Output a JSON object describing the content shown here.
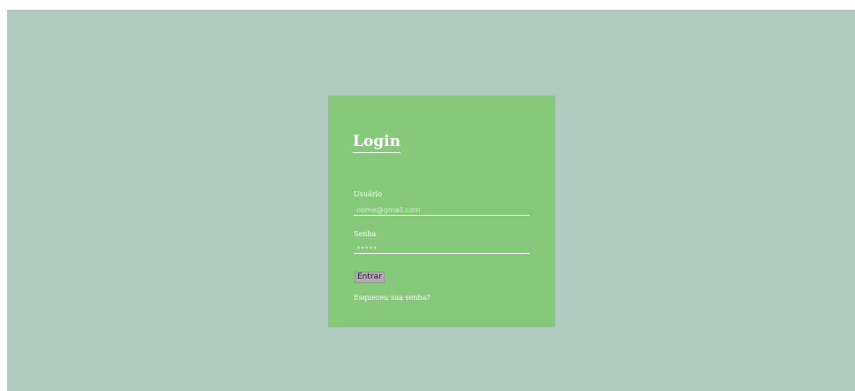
{
  "login": {
    "title": "Login",
    "user_label": "Usuário",
    "user_placeholder": "nome@gmail.com",
    "password_label": "Senha",
    "password_placeholder": "•••••",
    "submit_label": "Entrar",
    "forgot_label": "Esqueceu sua senha?"
  },
  "colors": {
    "page_background": "#afcbc0",
    "card_background": "#86c97a",
    "text": "#ffffff",
    "button_background": "#b6a9b9"
  }
}
